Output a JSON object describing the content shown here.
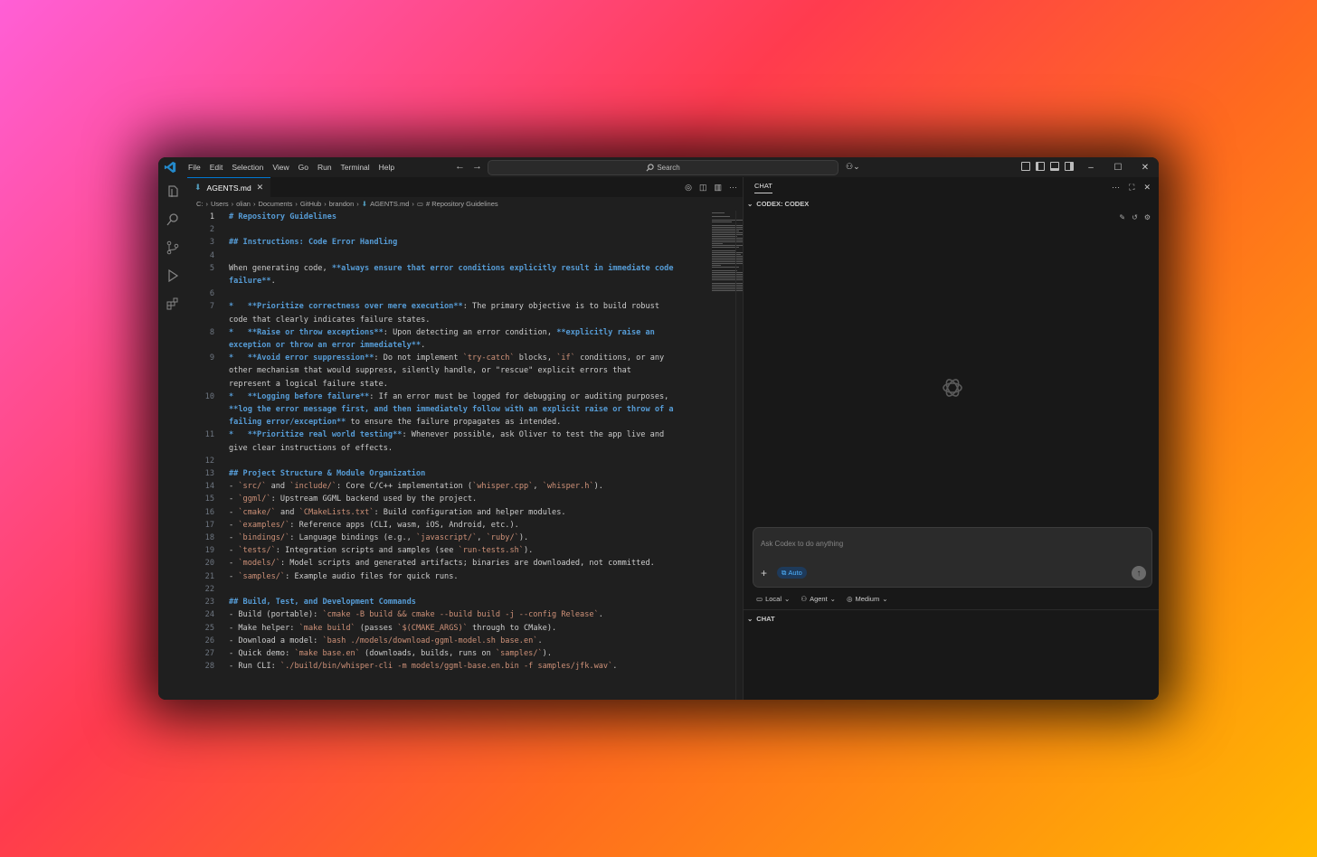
{
  "menu": [
    "File",
    "Edit",
    "Selection",
    "View",
    "Go",
    "Run",
    "Terminal",
    "Help"
  ],
  "search": {
    "label": "Search"
  },
  "editor": {
    "tab_label": "AGENTS.md",
    "breadcrumb": [
      "C:",
      "Users",
      "olian",
      "Documents",
      "GitHub",
      "brandon",
      "AGENTS.md",
      "# Repository Guidelines"
    ]
  },
  "code_lines": [
    {
      "n": "1",
      "cur": true,
      "segs": [
        [
          "h",
          "# Repository Guidelines"
        ]
      ]
    },
    {
      "n": "2",
      "segs": []
    },
    {
      "n": "3",
      "segs": [
        [
          "h",
          "## Instructions: Code Error Handling"
        ]
      ]
    },
    {
      "n": "4",
      "segs": []
    },
    {
      "n": "5",
      "segs": [
        [
          "t",
          "When generating code, "
        ],
        [
          "b",
          "**always ensure that error conditions explicitly result in immediate code failure**"
        ],
        [
          "t",
          "."
        ]
      ]
    },
    {
      "n": "6",
      "segs": []
    },
    {
      "n": "7",
      "segs": [
        [
          "b",
          "*   **Prioritize correctness over mere execution**"
        ],
        [
          "t",
          ": The primary objective is to build robust code that clearly indicates failure states."
        ]
      ]
    },
    {
      "n": "8",
      "segs": [
        [
          "b",
          "*   **Raise or throw exceptions**"
        ],
        [
          "t",
          ": Upon detecting an error condition, "
        ],
        [
          "b",
          "**explicitly raise an exception or throw an error immediately**"
        ],
        [
          "t",
          "."
        ]
      ]
    },
    {
      "n": "9",
      "segs": [
        [
          "b",
          "*   **Avoid error suppression**"
        ],
        [
          "t",
          ": Do not implement "
        ],
        [
          "c",
          "`try-catch`"
        ],
        [
          "t",
          " blocks, "
        ],
        [
          "c",
          "`if`"
        ],
        [
          "t",
          " conditions, or any other mechanism that would suppress, silently handle, or \"rescue\" explicit errors that represent a logical failure state."
        ]
      ]
    },
    {
      "n": "10",
      "segs": [
        [
          "b",
          "*   **Logging before failure**"
        ],
        [
          "t",
          ": If an error must be logged for debugging or auditing purposes, "
        ],
        [
          "b",
          "**log the error message first, and then immediately follow with an explicit raise or throw of a failing error/exception**"
        ],
        [
          "t",
          " to ensure the failure propagates as intended."
        ]
      ]
    },
    {
      "n": "11",
      "segs": [
        [
          "b",
          "*   **Prioritize real world testing**"
        ],
        [
          "t",
          ": Whenever possible, ask Oliver to test the app live and give clear instructions of effects."
        ]
      ]
    },
    {
      "n": "12",
      "segs": []
    },
    {
      "n": "13",
      "segs": [
        [
          "h",
          "## Project Structure & Module Organization"
        ]
      ]
    },
    {
      "n": "14",
      "segs": [
        [
          "t",
          "- "
        ],
        [
          "c",
          "`src/`"
        ],
        [
          "t",
          " and "
        ],
        [
          "c",
          "`include/`"
        ],
        [
          "t",
          ": Core C/C++ implementation ("
        ],
        [
          "c",
          "`whisper.cpp`"
        ],
        [
          "t",
          ", "
        ],
        [
          "c",
          "`whisper.h`"
        ],
        [
          "t",
          ")."
        ]
      ]
    },
    {
      "n": "15",
      "segs": [
        [
          "t",
          "- "
        ],
        [
          "c",
          "`ggml/`"
        ],
        [
          "t",
          ": Upstream GGML backend used by the project."
        ]
      ]
    },
    {
      "n": "16",
      "segs": [
        [
          "t",
          "- "
        ],
        [
          "c",
          "`cmake/`"
        ],
        [
          "t",
          " and "
        ],
        [
          "c",
          "`CMakeLists.txt`"
        ],
        [
          "t",
          ": Build configuration and helper modules."
        ]
      ]
    },
    {
      "n": "17",
      "segs": [
        [
          "t",
          "- "
        ],
        [
          "c",
          "`examples/`"
        ],
        [
          "t",
          ": Reference apps (CLI, wasm, iOS, Android, etc.)."
        ]
      ]
    },
    {
      "n": "18",
      "segs": [
        [
          "t",
          "- "
        ],
        [
          "c",
          "`bindings/`"
        ],
        [
          "t",
          ": Language bindings (e.g., "
        ],
        [
          "c",
          "`javascript/`"
        ],
        [
          "t",
          ", "
        ],
        [
          "c",
          "`ruby/`"
        ],
        [
          "t",
          ")."
        ]
      ]
    },
    {
      "n": "19",
      "segs": [
        [
          "t",
          "- "
        ],
        [
          "c",
          "`tests/`"
        ],
        [
          "t",
          ": Integration scripts and samples (see "
        ],
        [
          "c",
          "`run-tests.sh`"
        ],
        [
          "t",
          ")."
        ]
      ]
    },
    {
      "n": "20",
      "segs": [
        [
          "t",
          "- "
        ],
        [
          "c",
          "`models/`"
        ],
        [
          "t",
          ": Model scripts and generated artifacts; binaries are downloaded, not committed."
        ]
      ]
    },
    {
      "n": "21",
      "segs": [
        [
          "t",
          "- "
        ],
        [
          "c",
          "`samples/`"
        ],
        [
          "t",
          ": Example audio files for quick runs."
        ]
      ]
    },
    {
      "n": "22",
      "segs": []
    },
    {
      "n": "23",
      "segs": [
        [
          "h",
          "## Build, Test, and Development Commands"
        ]
      ]
    },
    {
      "n": "24",
      "segs": [
        [
          "t",
          "- Build (portable): "
        ],
        [
          "c",
          "`cmake -B build && cmake --build build -j --config Release`"
        ],
        [
          "t",
          "."
        ]
      ]
    },
    {
      "n": "25",
      "segs": [
        [
          "t",
          "- Make helper: "
        ],
        [
          "c",
          "`make build`"
        ],
        [
          "t",
          " (passes "
        ],
        [
          "c",
          "`$(CMAKE_ARGS)`"
        ],
        [
          "t",
          " through to CMake)."
        ]
      ]
    },
    {
      "n": "26",
      "segs": [
        [
          "t",
          "- Download a model: "
        ],
        [
          "c",
          "`bash ./models/download-ggml-model.sh base.en`"
        ],
        [
          "t",
          "."
        ]
      ]
    },
    {
      "n": "27",
      "segs": [
        [
          "t",
          "- Quick demo: "
        ],
        [
          "c",
          "`make base.en`"
        ],
        [
          "t",
          " (downloads, builds, runs on "
        ],
        [
          "c",
          "`samples/`"
        ],
        [
          "t",
          ")."
        ]
      ]
    },
    {
      "n": "28",
      "segs": [
        [
          "t",
          "- Run CLI: "
        ],
        [
          "c",
          "`./build/bin/whisper-cli -m models/ggml-base.en.bin -f samples/jfk.wav`"
        ],
        [
          "t",
          "."
        ]
      ]
    }
  ],
  "chat": {
    "header": "CHAT",
    "section_title": "CODEX: CODEX",
    "input_placeholder": "Ask Codex to do anything",
    "auto_label": "Auto",
    "opt_local": "Local",
    "opt_agent": "Agent",
    "opt_medium": "Medium",
    "bottom_section": "CHAT"
  },
  "colors": {
    "accent": "#0078d4",
    "keyword": "#569cd6",
    "string": "#ce9178"
  }
}
